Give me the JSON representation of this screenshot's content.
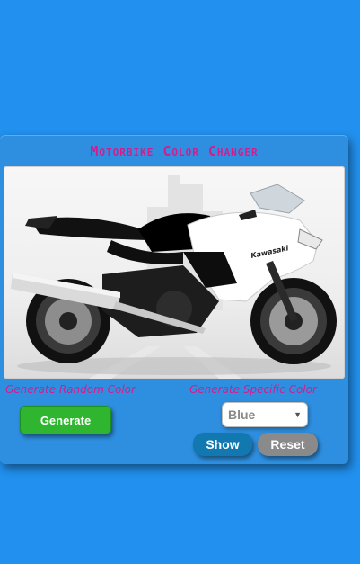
{
  "app": {
    "title": "Motorbike Color Changer"
  },
  "image": {
    "subject": "motorbike-image",
    "brand_text": "Kawasaki"
  },
  "random_section": {
    "label": "Generate Random Color",
    "button_label": "Generate"
  },
  "specific_section": {
    "label": "Generate Specific Color",
    "select_value": "Blue",
    "show_label": "Show",
    "reset_label": "Reset"
  },
  "colors": {
    "page_background": "#2190ee",
    "title_color": "#d81b8c",
    "generate_button": "#2fb52f",
    "show_button": "#1279b0",
    "reset_button": "#8a8a8a",
    "bike_body": "#ffffff"
  }
}
